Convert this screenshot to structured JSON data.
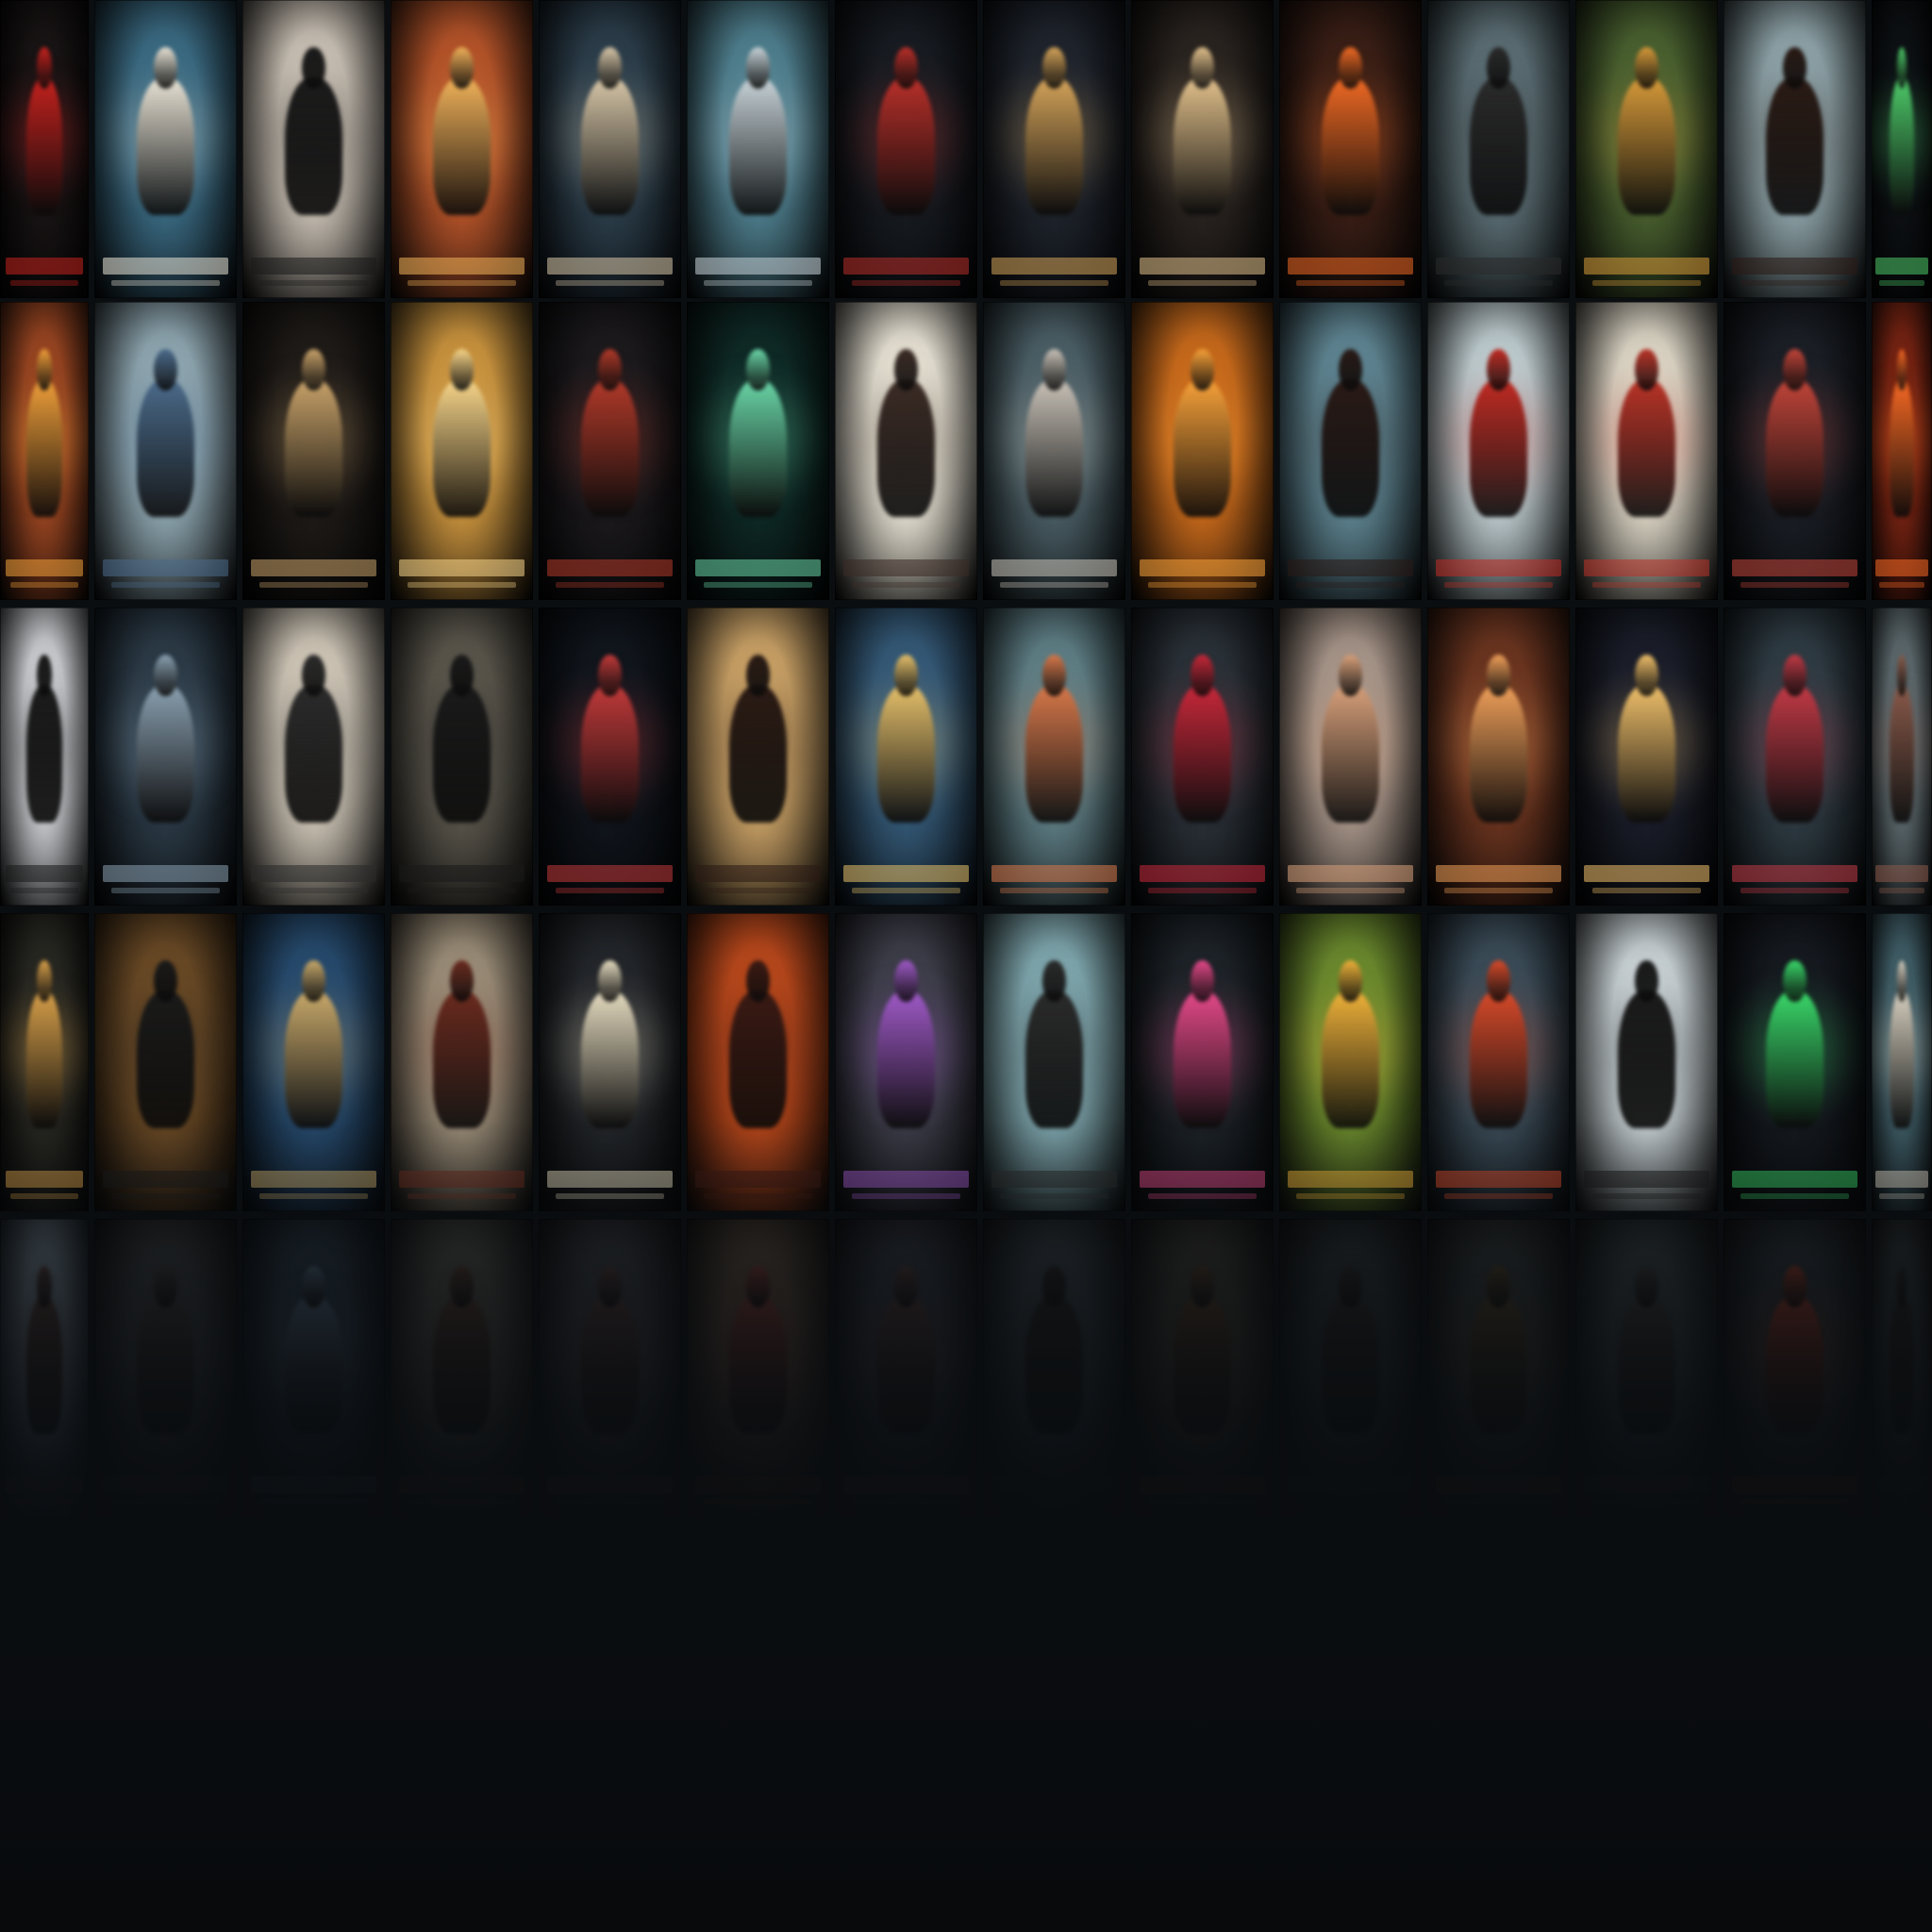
{
  "palette": {
    "background": "#0a0d10",
    "rows": [
      [
        "#1a1516",
        "#3b6b83",
        "#c9c0b4",
        "#b5542a",
        "#2c3e4b",
        "#4f7f8e",
        "#181c22",
        "#1f242d",
        "#2a2420",
        "#3a1f16",
        "#5b6e74",
        "#4a6130",
        "#8ea3a8",
        "#101418"
      ],
      [
        "#a34a24",
        "#8fa7b1",
        "#1f1b18",
        "#c9933e",
        "#1c1a1d",
        "#0f2a26",
        "#e6e1d3",
        "#4b5f66",
        "#c86a1c",
        "#5f8592",
        "#bfcdd0",
        "#ddd6c6",
        "#1b1f26",
        "#8c2a16"
      ],
      [
        "#d8dade",
        "#2c3b47",
        "#cfc6b7",
        "#5a564c",
        "#11161d",
        "#c9a166",
        "#355a78",
        "#5f7f86",
        "#2a3138",
        "#a8968a",
        "#6b3520",
        "#1b1e2a",
        "#2f3c44",
        "#6e7d82"
      ],
      [
        "#2a2a24",
        "#6a4a26",
        "#274b6e",
        "#9b8d78",
        "#23262a",
        "#b8481c",
        "#3e3e4a",
        "#7fa7ae",
        "#1d2328",
        "#6b8a2e",
        "#3b4c58",
        "#c9d2d5",
        "#161a20",
        "#4c6f7a"
      ],
      [
        "#54606a",
        "#2a2c2e",
        "#1f2a33",
        "#3a3a36",
        "#2a2c30",
        "#40352c",
        "#25282e",
        "#2a2f33",
        "#2b2a26",
        "#222628",
        "#26292a",
        "#2a3032",
        "#22262a",
        "#2a2e30"
      ]
    ],
    "accents": [
      [
        "#c4221e",
        "#e9e3d5",
        "#1a1a1a",
        "#f0b25a",
        "#d8c7a8",
        "#c8d3d8",
        "#b9302a",
        "#d5a45a",
        "#e2c18c",
        "#f06a24",
        "#2a2a2a",
        "#d79a3a",
        "#2a1a14",
        "#4ecb6a"
      ],
      [
        "#f0a03a",
        "#4a6a8a",
        "#c9a36a",
        "#f8d68a",
        "#b23a2a",
        "#6ad6a8",
        "#3a2a24",
        "#c9c2b8",
        "#f8a23a",
        "#2a1a16",
        "#c02a22",
        "#b93226",
        "#c2453a",
        "#f86a24"
      ],
      [
        "#1a1a1a",
        "#8aa0b0",
        "#2a2a2a",
        "#1a1a1a",
        "#c23a3a",
        "#2a1a14",
        "#e6c06a",
        "#d8784a",
        "#c8283a",
        "#d8a07a",
        "#f0a05a",
        "#f0c06a",
        "#c23a46",
        "#8a5a4a"
      ],
      [
        "#d8a04a",
        "#1a1a1a",
        "#c9a96a",
        "#6a2a1e",
        "#e6dcc0",
        "#3a1a14",
        "#a05ac8",
        "#2a2a2a",
        "#e64a8a",
        "#f0b23a",
        "#d84a2a",
        "#1a1a1a",
        "#3ad86a",
        "#d8d0c0"
      ],
      [
        "#3a2a26",
        "#2a2a2a",
        "#3a4a5a",
        "#3a2a22",
        "#3a2a2a",
        "#5a2a26",
        "#3a2a2a",
        "#1a1a1a",
        "#3a2a1e",
        "#1e1e1e",
        "#3a2e1e",
        "#2a2a2a",
        "#6a2a1e",
        "#1a1a1a"
      ]
    ]
  }
}
